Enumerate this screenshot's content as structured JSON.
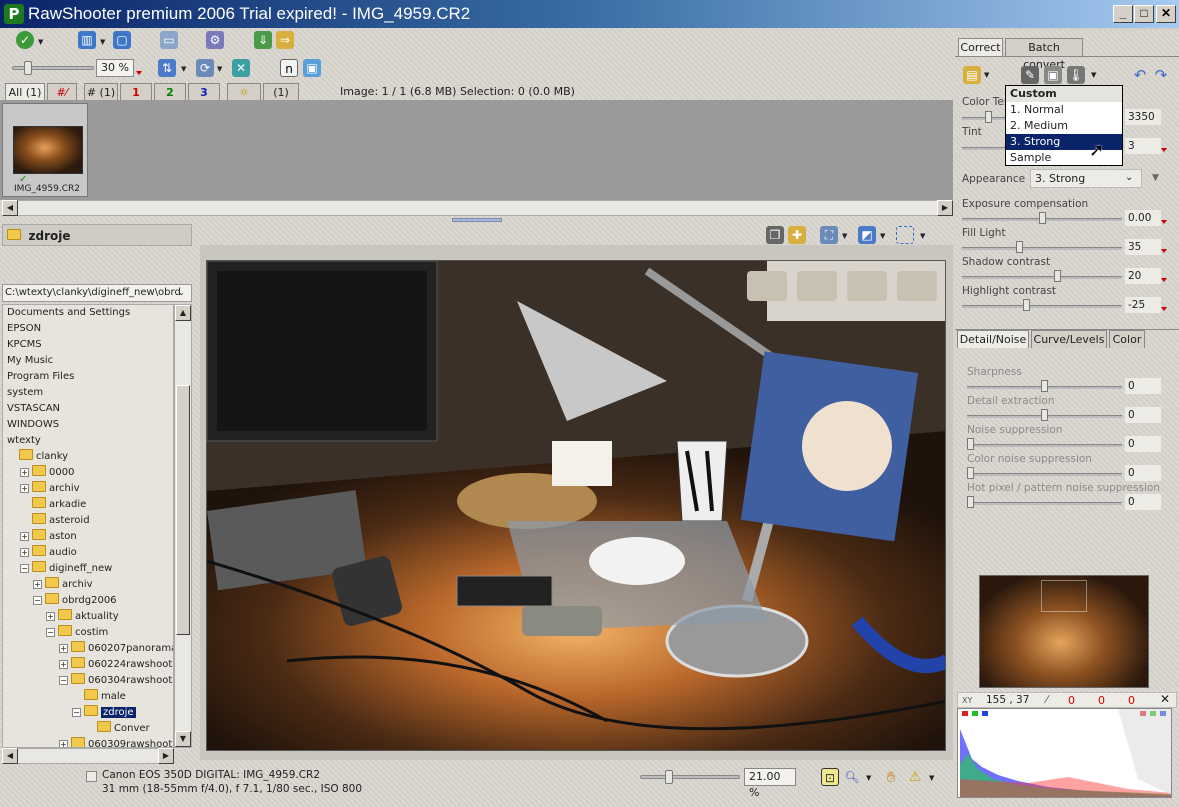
{
  "window": {
    "title": "RawShooter premium 2006 Trial expired! - IMG_4959.CR2",
    "app_letter": "P"
  },
  "toolbar": {
    "zoom_level": "30 %"
  },
  "filter_tabs": [
    {
      "label": "All (1)",
      "color": "#222222"
    },
    {
      "label": "#⁄",
      "color": "#c00000"
    },
    {
      "label": "# (1)",
      "color": "#222222"
    },
    {
      "label": "1",
      "color": "#d00000"
    },
    {
      "label": "2",
      "color": "#008000"
    },
    {
      "label": "3",
      "color": "#1020c0"
    },
    {
      "label": "☼",
      "color": "#c09000"
    },
    {
      "label": "(1)",
      "color": "#222222"
    }
  ],
  "image_info": "Image: 1 / 1 (6.8 MB) Selection: 0 (0.0 MB)",
  "thumbnail": {
    "name": "IMG_4959.CR2"
  },
  "folder": {
    "title": "zdroje",
    "path": "C:\\wtexty\\clanky\\digineff_new\\obrd"
  },
  "tree": [
    {
      "label": "Documents and Settings",
      "indent": 0,
      "icon": false,
      "expander": ""
    },
    {
      "label": "EPSON",
      "indent": 0,
      "icon": false,
      "expander": ""
    },
    {
      "label": "KPCMS",
      "indent": 0,
      "icon": false,
      "expander": ""
    },
    {
      "label": "My Music",
      "indent": 0,
      "icon": false,
      "expander": ""
    },
    {
      "label": "Program Files",
      "indent": 0,
      "icon": false,
      "expander": ""
    },
    {
      "label": "system",
      "indent": 0,
      "icon": false,
      "expander": ""
    },
    {
      "label": "VSTASCAN",
      "indent": 0,
      "icon": false,
      "expander": ""
    },
    {
      "label": "WINDOWS",
      "indent": 0,
      "icon": false,
      "expander": ""
    },
    {
      "label": "wtexty",
      "indent": 0,
      "icon": false,
      "expander": ""
    },
    {
      "label": "clanky",
      "indent": 0,
      "icon": true,
      "expander": ""
    },
    {
      "label": "0000",
      "indent": 1,
      "icon": true,
      "expander": "+"
    },
    {
      "label": "archiv",
      "indent": 1,
      "icon": true,
      "expander": "+"
    },
    {
      "label": "arkadie",
      "indent": 1,
      "icon": true,
      "expander": ""
    },
    {
      "label": "asteroid",
      "indent": 1,
      "icon": true,
      "expander": ""
    },
    {
      "label": "aston",
      "indent": 1,
      "icon": true,
      "expander": "+"
    },
    {
      "label": "audio",
      "indent": 1,
      "icon": true,
      "expander": "+"
    },
    {
      "label": "digineff_new",
      "indent": 1,
      "icon": true,
      "expander": "-"
    },
    {
      "label": "archiv",
      "indent": 2,
      "icon": true,
      "expander": "+"
    },
    {
      "label": "obrdg2006",
      "indent": 2,
      "icon": true,
      "expander": "-"
    },
    {
      "label": "aktuality",
      "indent": 3,
      "icon": true,
      "expander": "+"
    },
    {
      "label": "costim",
      "indent": 3,
      "icon": true,
      "expander": "-"
    },
    {
      "label": "060207panorama",
      "indent": 4,
      "icon": true,
      "expander": "+"
    },
    {
      "label": "060224rawshoot",
      "indent": 4,
      "icon": true,
      "expander": "+"
    },
    {
      "label": "060304rawshoot",
      "indent": 4,
      "icon": true,
      "expander": "-"
    },
    {
      "label": "male",
      "indent": 5,
      "icon": true,
      "expander": ""
    },
    {
      "label": "zdroje",
      "indent": 5,
      "icon": true,
      "expander": "-",
      "selected": true
    },
    {
      "label": "Conver",
      "indent": 6,
      "icon": true,
      "expander": ""
    },
    {
      "label": "060309rawshoot",
      "indent": 4,
      "icon": true,
      "expander": "+"
    }
  ],
  "status": {
    "camera": "Canon EOS 350D DIGITAL:  IMG_4959.CR2",
    "exposure": "31 mm (18-55mm f/4.0), f 7.1, 1/80 sec., ISO 800",
    "zoom": "21.00 %"
  },
  "right_tabs": [
    "Correct",
    "Batch convert"
  ],
  "color_temp": {
    "label": "Color Temperature",
    "value": "3350"
  },
  "tint": {
    "label": "Tint",
    "value": "3"
  },
  "dropdown": {
    "header": "Custom",
    "items": [
      "1. Normal",
      "2. Medium",
      "3. Strong",
      "Sample"
    ],
    "selected_index": 2
  },
  "appearance": {
    "label": "Appearance",
    "value": "3. Strong"
  },
  "sliders": [
    {
      "label": "Exposure compensation",
      "value": "0.00",
      "level": 0.5
    },
    {
      "label": "Fill Light",
      "value": "35",
      "level": 0.35
    },
    {
      "label": "Shadow contrast",
      "value": "20",
      "level": 0.6
    },
    {
      "label": "Highlight contrast",
      "value": "-25",
      "level": 0.4
    }
  ],
  "detail_tabs": [
    "Detail/Noise",
    "Curve/Levels",
    "Color"
  ],
  "detail_sliders": [
    {
      "label": "Sharpness",
      "value": "0",
      "level": 0.5
    },
    {
      "label": "Detail extraction",
      "value": "0",
      "level": 0.5
    },
    {
      "label": "Noise suppression",
      "value": "0",
      "level": 0.0
    },
    {
      "label": "Color noise suppression",
      "value": "0",
      "level": 0.0
    },
    {
      "label": "Hot pixel / pattern noise suppression",
      "value": "0",
      "level": 0.0
    }
  ],
  "readout": {
    "xy_label": "XY",
    "xy": "155 , 37",
    "r": "0",
    "g": "0",
    "b": "0"
  },
  "colors": {
    "accent": "#0a246a",
    "title_start": "#0a246a",
    "title_end": "#a6caf0",
    "readout_red": "#d00000"
  }
}
